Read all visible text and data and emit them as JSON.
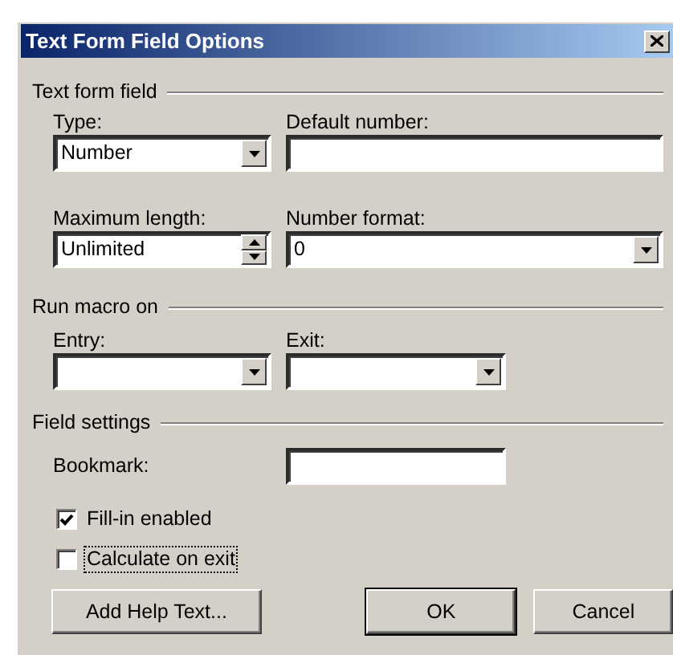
{
  "window": {
    "title": "Text Form Field Options"
  },
  "sections": [
    {
      "title": "Text form field",
      "fields": [
        {
          "kind": "select",
          "label": "Type:",
          "value": "Number"
        },
        {
          "kind": "text",
          "label": "Default number:"
        },
        {
          "kind": "spin",
          "label": "Maximum length:",
          "value": "Unlimited"
        },
        {
          "kind": "select",
          "label": "Number format:",
          "value": "0"
        }
      ]
    },
    {
      "title": "Run macro on",
      "fields": [
        {
          "kind": "select",
          "label": "Entry:"
        },
        {
          "kind": "select",
          "label": "Exit:"
        }
      ]
    },
    {
      "title": "Field settings",
      "bookmark": {
        "label": "Bookmark:"
      },
      "checkboxes": [
        {
          "label": "Fill-in enabled",
          "checked": true,
          "focused": false
        },
        {
          "label": "Calculate on exit",
          "checked": false,
          "focused": true
        }
      ]
    }
  ],
  "buttons": [
    {
      "label": "Add Help Text...",
      "default": false
    },
    {
      "label": "OK",
      "default": true
    },
    {
      "label": "Cancel",
      "default": false
    }
  ]
}
